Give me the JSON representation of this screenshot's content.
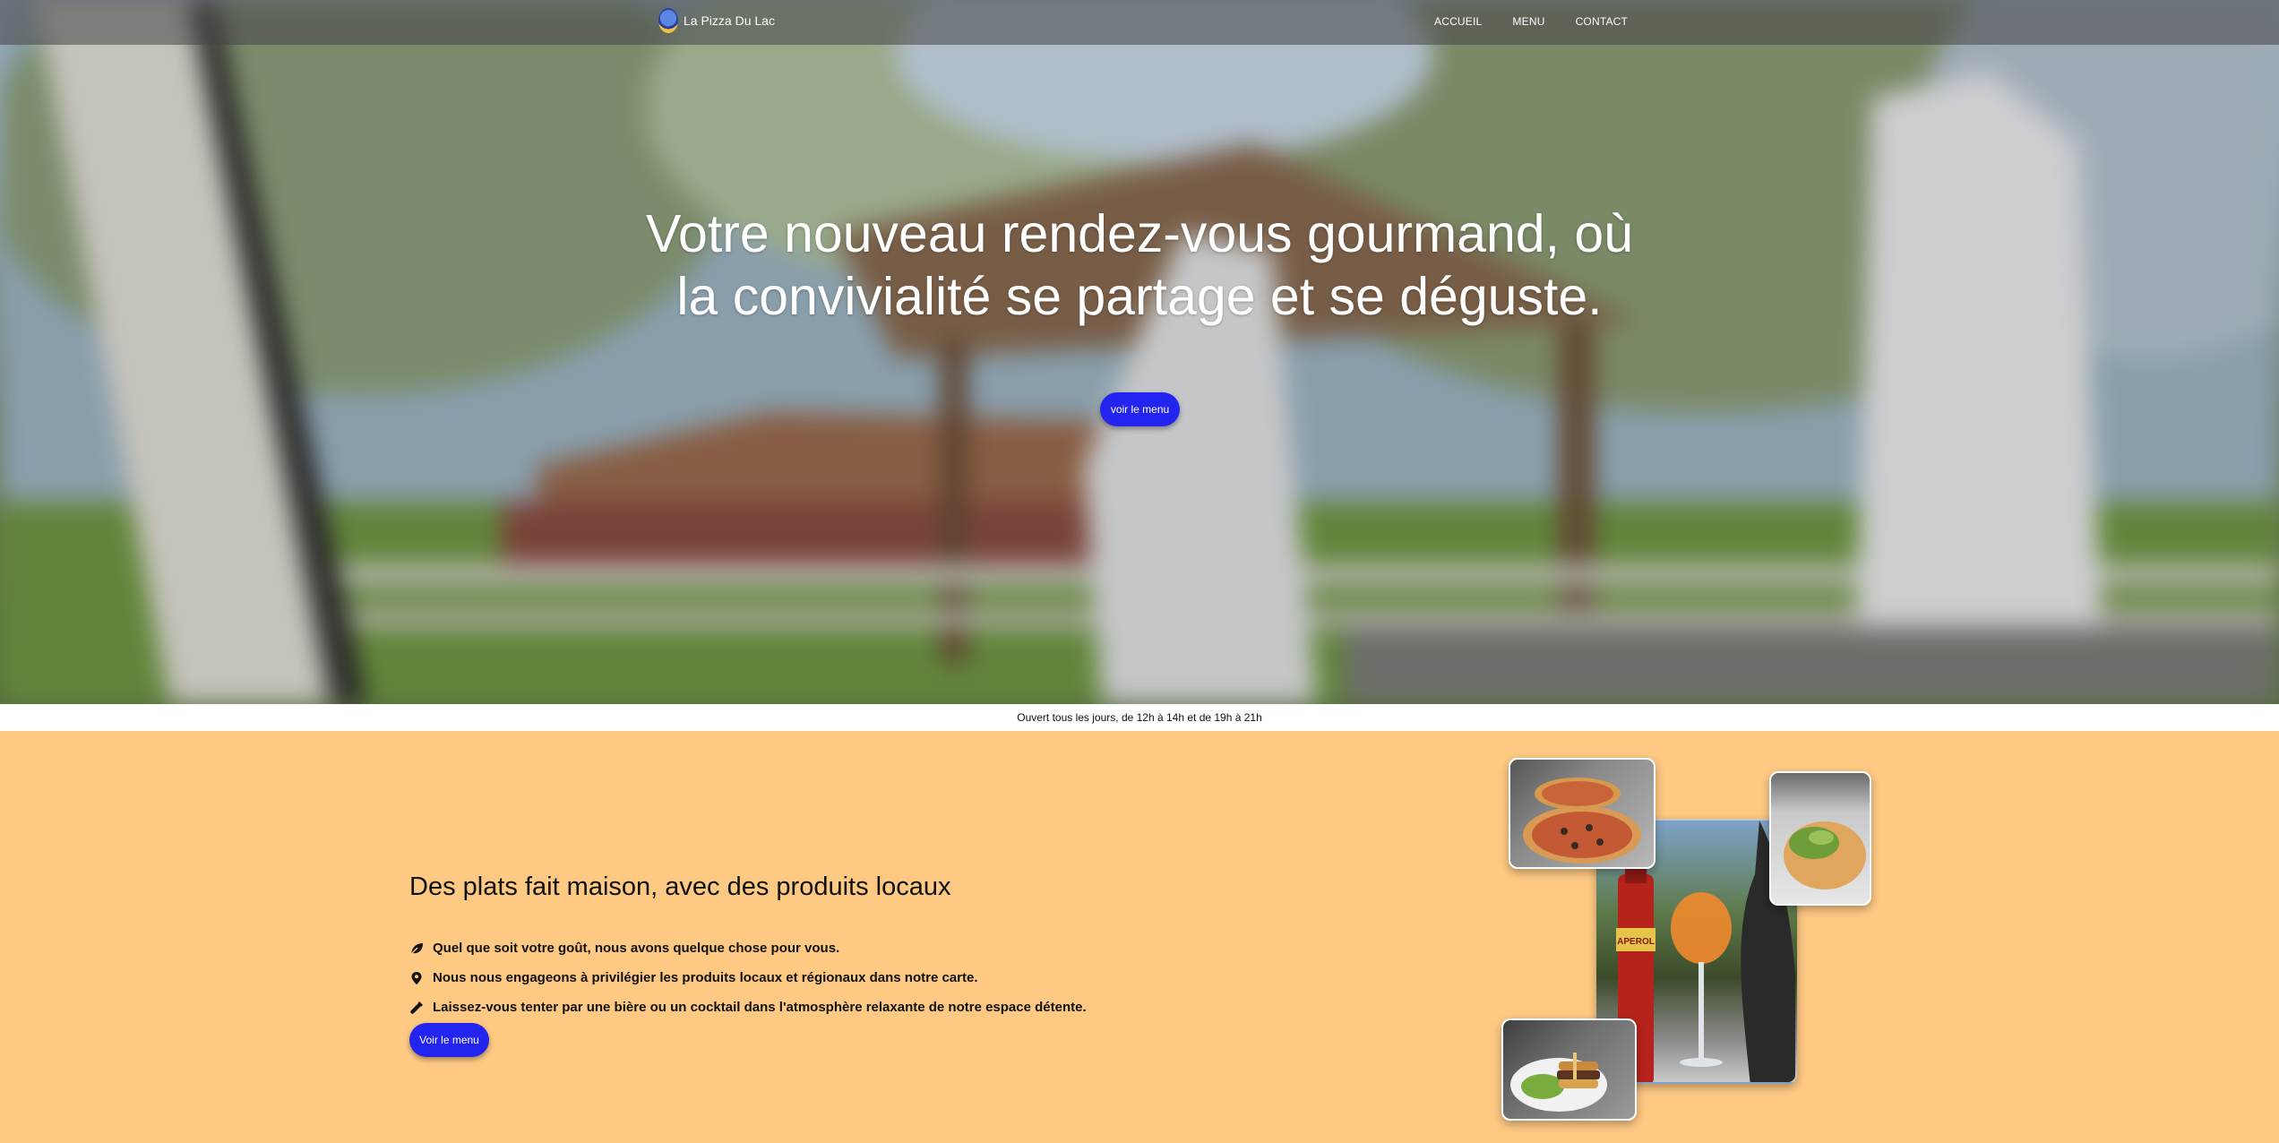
{
  "nav": {
    "brand": "La Pizza Du Lac",
    "links": [
      "ACCUEIL",
      "MENU",
      "CONTACT"
    ]
  },
  "hero": {
    "title": "Votre nouveau rendez-vous gourmand, où la convivialité se partage et se déguste.",
    "button": "voir le menu"
  },
  "hours": "Ouvert tous les jours, de 12h à 14h et de 19h à 21h",
  "feature": {
    "title": "Des plats fait maison, avec des produits locaux",
    "items": [
      {
        "icon": "leaf-icon",
        "text": "Quel que soit votre goût, nous avons quelque chose pour vous."
      },
      {
        "icon": "map-pin-icon",
        "text": "Nous nous engageons à privilégier les produits locaux et régionaux dans notre carte."
      },
      {
        "icon": "bottle-icon",
        "text": "Laissez-vous tenter par une bière ou un cocktail dans l'atmosphère relaxante de notre espace détente."
      }
    ],
    "button": "Voir le menu"
  },
  "photos": {
    "drink_label": "APEROL"
  },
  "colors": {
    "accent": "#2424f0",
    "feature_bg": "#fdc983"
  }
}
